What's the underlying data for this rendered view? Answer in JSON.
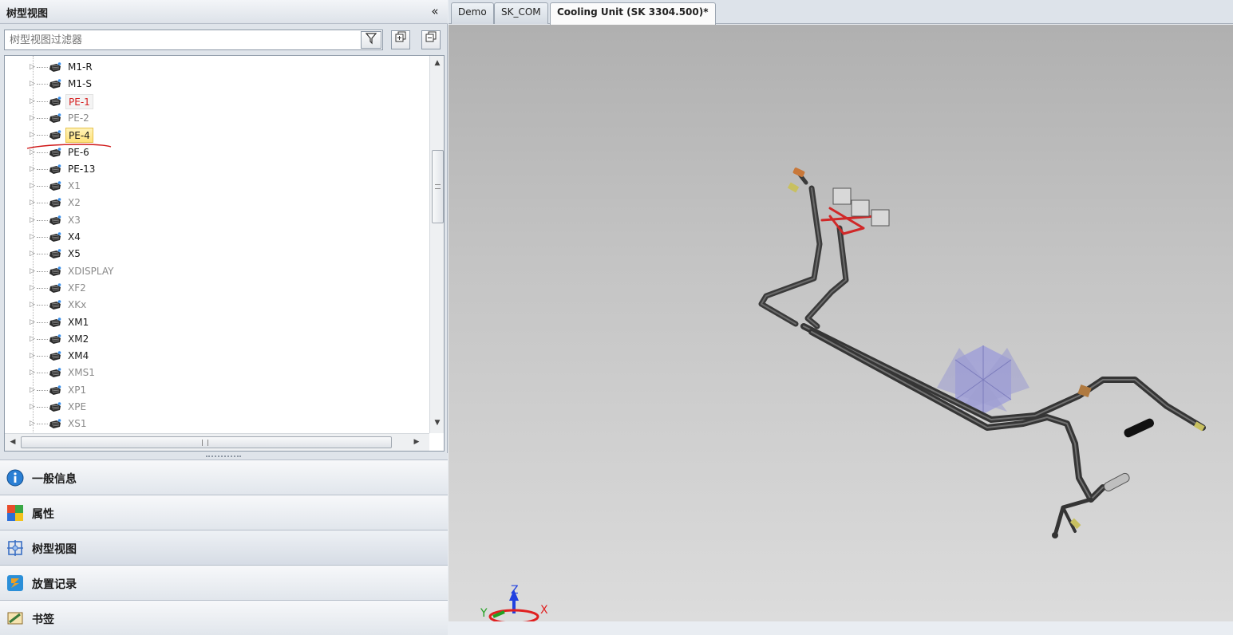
{
  "panel": {
    "title": "树型视图",
    "collapse_glyph": "«",
    "filter_placeholder": "树型视图过滤器",
    "funnel_icon": "funnel-icon",
    "expand_all_icon": "expand-all-icon",
    "collapse_all_icon": "collapse-all-icon"
  },
  "tree": {
    "items": [
      {
        "label": "M1-R",
        "style": "normal"
      },
      {
        "label": "M1-S",
        "style": "normal"
      },
      {
        "label": "PE-1",
        "style": "red"
      },
      {
        "label": "PE-2",
        "style": "gray"
      },
      {
        "label": "PE-4",
        "style": "selected"
      },
      {
        "label": "PE-6",
        "style": "normal"
      },
      {
        "label": "PE-13",
        "style": "normal"
      },
      {
        "label": "X1",
        "style": "gray"
      },
      {
        "label": "X2",
        "style": "gray"
      },
      {
        "label": "X3",
        "style": "gray"
      },
      {
        "label": "X4",
        "style": "normal"
      },
      {
        "label": "X5",
        "style": "normal"
      },
      {
        "label": "XDISPLAY",
        "style": "gray"
      },
      {
        "label": "XF2",
        "style": "gray"
      },
      {
        "label": "XKx",
        "style": "gray"
      },
      {
        "label": "XM1",
        "style": "normal"
      },
      {
        "label": "XM2",
        "style": "normal"
      },
      {
        "label": "XM4",
        "style": "normal"
      },
      {
        "label": "XMS1",
        "style": "gray"
      },
      {
        "label": "XP1",
        "style": "gray"
      },
      {
        "label": "XPE",
        "style": "gray"
      },
      {
        "label": "XS1",
        "style": "gray"
      }
    ],
    "vscroll_fraction": 0.3
  },
  "nav": [
    {
      "label": "一般信息",
      "icon": "info-icon"
    },
    {
      "label": "属性",
      "icon": "properties-icon"
    },
    {
      "label": "树型视图",
      "icon": "tree-view-icon",
      "active": true
    },
    {
      "label": "放置记录",
      "icon": "placement-log-icon"
    },
    {
      "label": "书签",
      "icon": "bookmark-icon"
    }
  ],
  "tabs": [
    {
      "label": "Demo"
    },
    {
      "label": "SK_COM"
    },
    {
      "label": "Cooling Unit (SK 3304.500)*",
      "active": true
    }
  ],
  "viewport": {
    "axes": {
      "z": "Z",
      "x": "X",
      "y": "Y"
    },
    "colors": {
      "axis_x": "#e02020",
      "axis_y": "#20a020",
      "axis_z": "#2040e0",
      "annotation": "#d01818"
    }
  }
}
